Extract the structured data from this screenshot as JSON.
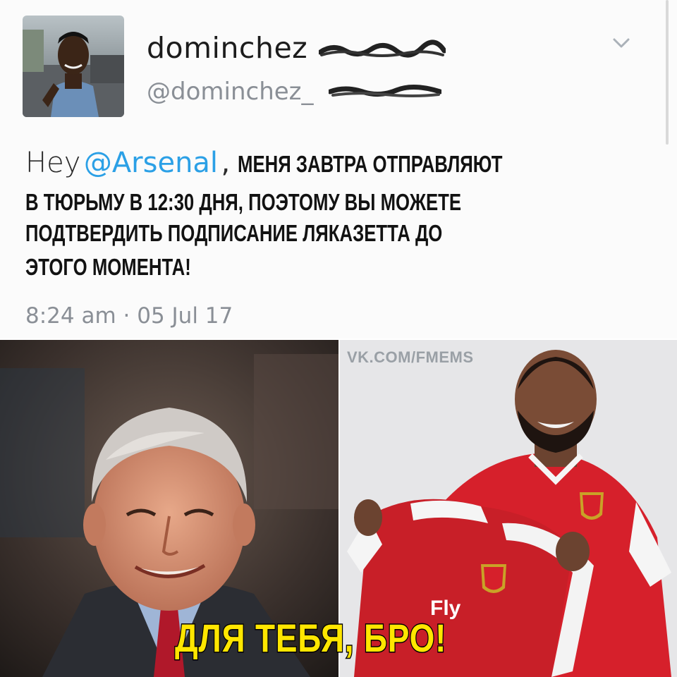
{
  "tweet": {
    "display_name": "dominchez",
    "handle": "@dominchez_",
    "greeting": "Hey",
    "mention": "@Arsenal",
    "comma": ",",
    "body_lines": [
      "МЕНЯ  ЗАВТРА  ОТПРАВЛЯЮТ",
      "В ТЮРЬМУ В 12:30 ДНЯ, ПОЭТОМУ ВЫ МОЖЕТЕ",
      "ПОДТВЕРДИТЬ ПОДПИСАНИЕ ЛЯКАЗЕТТА ДО",
      "ЭТОГО МОМЕНТА!"
    ],
    "timestamp": "8:24 am · 05 Jul 17",
    "menu_icon": "chevron-down-icon"
  },
  "photos": {
    "watermark": "VK.COM/FMEMS",
    "caption": "ДЛЯ ТЕБЯ, БРО!",
    "jersey_sponsor": "Fly"
  },
  "colors": {
    "mention": "#2ba0e6",
    "caption": "#ffe600",
    "arsenal_red": "#d6202b"
  }
}
